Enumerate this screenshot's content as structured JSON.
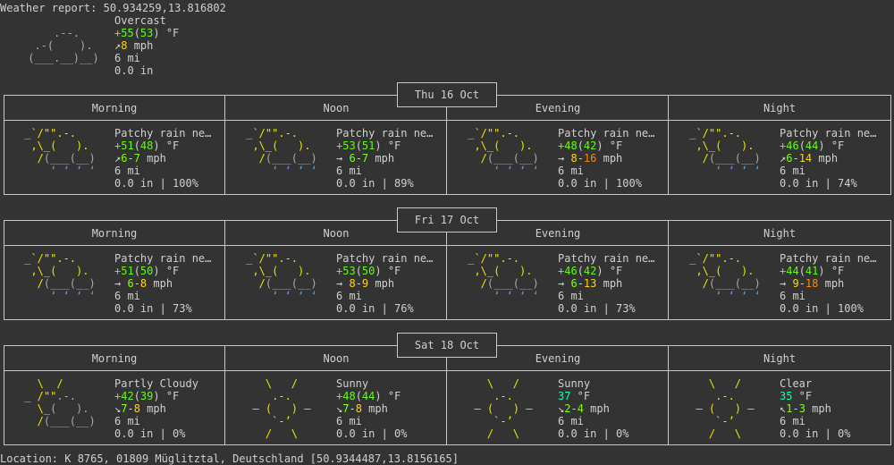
{
  "header": {
    "title": "Weather report: 50.934259,13.816802",
    "condition": "Overcast",
    "temp_a": "+55",
    "temp_b": "53",
    "temp_unit": "°F",
    "wind_arrow": "↗",
    "wind": "8",
    "wind_unit": "mph",
    "visibility": "6 mi",
    "precip": "0.0 in",
    "icon": "cloud-icon"
  },
  "periods": [
    "Morning",
    "Noon",
    "Evening",
    "Night"
  ],
  "days": [
    {
      "date": "Thu 16 Oct",
      "slots": [
        {
          "icon": "rain-icon",
          "desc": "Patchy rain ne…",
          "ta": "+51",
          "tb": "48",
          "tunit": "°F",
          "arrow": "↗",
          "w1": "6",
          "w2": "7",
          "wunit": "mph",
          "vis": "6 mi",
          "precip": "0.0 in | 100%"
        },
        {
          "icon": "rain-icon",
          "desc": "Patchy rain ne…",
          "ta": "+53",
          "tb": "51",
          "tunit": "°F",
          "arrow": "→",
          "w1": "6",
          "w2": "7",
          "wunit": "mph",
          "vis": "6 mi",
          "precip": "0.0 in | 89%"
        },
        {
          "icon": "rain-icon",
          "desc": "Patchy rain ne…",
          "ta": "+48",
          "tb": "42",
          "tunit": "°F",
          "arrow": "→",
          "w1": "8",
          "w2": "16",
          "wunit": "mph",
          "vis": "6 mi",
          "precip": "0.0 in | 100%"
        },
        {
          "icon": "rain-icon",
          "desc": "Patchy rain ne…",
          "ta": "+46",
          "tb": "44",
          "tunit": "°F",
          "arrow": "↗",
          "w1": "6",
          "w2": "14",
          "wunit": "mph",
          "vis": "6 mi",
          "precip": "0.0 in | 74%"
        }
      ]
    },
    {
      "date": "Fri 17 Oct",
      "slots": [
        {
          "icon": "rain-icon",
          "desc": "Patchy rain ne…",
          "ta": "+51",
          "tb": "50",
          "tunit": "°F",
          "arrow": "→",
          "w1": "6",
          "w2": "8",
          "wunit": "mph",
          "vis": "6 mi",
          "precip": "0.0 in | 73%"
        },
        {
          "icon": "rain-icon",
          "desc": "Patchy rain ne…",
          "ta": "+53",
          "tb": "50",
          "tunit": "°F",
          "arrow": "→",
          "w1": "8",
          "w2": "9",
          "wunit": "mph",
          "vis": "6 mi",
          "precip": "0.0 in | 76%"
        },
        {
          "icon": "rain-icon",
          "desc": "Patchy rain ne…",
          "ta": "+46",
          "tb": "42",
          "tunit": "°F",
          "arrow": "→",
          "w1": "6",
          "w2": "13",
          "wunit": "mph",
          "vis": "6 mi",
          "precip": "0.0 in | 73%"
        },
        {
          "icon": "rain-icon",
          "desc": "Patchy rain ne…",
          "ta": "+44",
          "tb": "41",
          "tunit": "°F",
          "arrow": "→",
          "w1": "9",
          "w2": "18",
          "wunit": "mph",
          "vis": "6 mi",
          "precip": "0.0 in | 100%"
        }
      ]
    },
    {
      "date": "Sat 18 Oct",
      "slots": [
        {
          "icon": "partly-cloudy-icon",
          "desc": "Partly Cloudy",
          "ta": "+42",
          "tb": "39",
          "tunit": "°F",
          "arrow": "↘",
          "w1": "7",
          "w2": "8",
          "wunit": "mph",
          "vis": "6 mi",
          "precip": "0.0 in | 0%"
        },
        {
          "icon": "sun-icon",
          "desc": "Sunny",
          "ta": "+48",
          "tb": "44",
          "tunit": "°F",
          "arrow": "↘",
          "w1": "7",
          "w2": "8",
          "wunit": "mph",
          "vis": "6 mi",
          "precip": "0.0 in | 0%"
        },
        {
          "icon": "sun-icon",
          "desc": "Sunny",
          "ta": "37",
          "tb": "",
          "tunit": "°F",
          "arrow": "↘",
          "w1": "2",
          "w2": "4",
          "wunit": "mph",
          "vis": "6 mi",
          "precip": "0.0 in | 0%"
        },
        {
          "icon": "sun-icon",
          "desc": "Clear",
          "ta": "35",
          "tb": "",
          "tunit": "°F",
          "arrow": "↖",
          "w1": "1",
          "w2": "3",
          "wunit": "mph",
          "vis": "6 mi",
          "precip": "0.0 in | 0%"
        }
      ]
    }
  ],
  "footer": {
    "location": "Location: K 8765, 01809 Müglitztal, Deutschland [50.9344487,13.8156165]"
  },
  "colors": {
    "background": "#333333",
    "text": "#d0d0d0",
    "temp_green": "#5fff00",
    "temp_teal": "#00ffaf",
    "wind_green": "#87ff00",
    "wind_yellow": "#ffd700",
    "wind_orange": "#ff8700",
    "sun_yellow": "#e6e600",
    "rain_blue": "#6f9ad8"
  }
}
